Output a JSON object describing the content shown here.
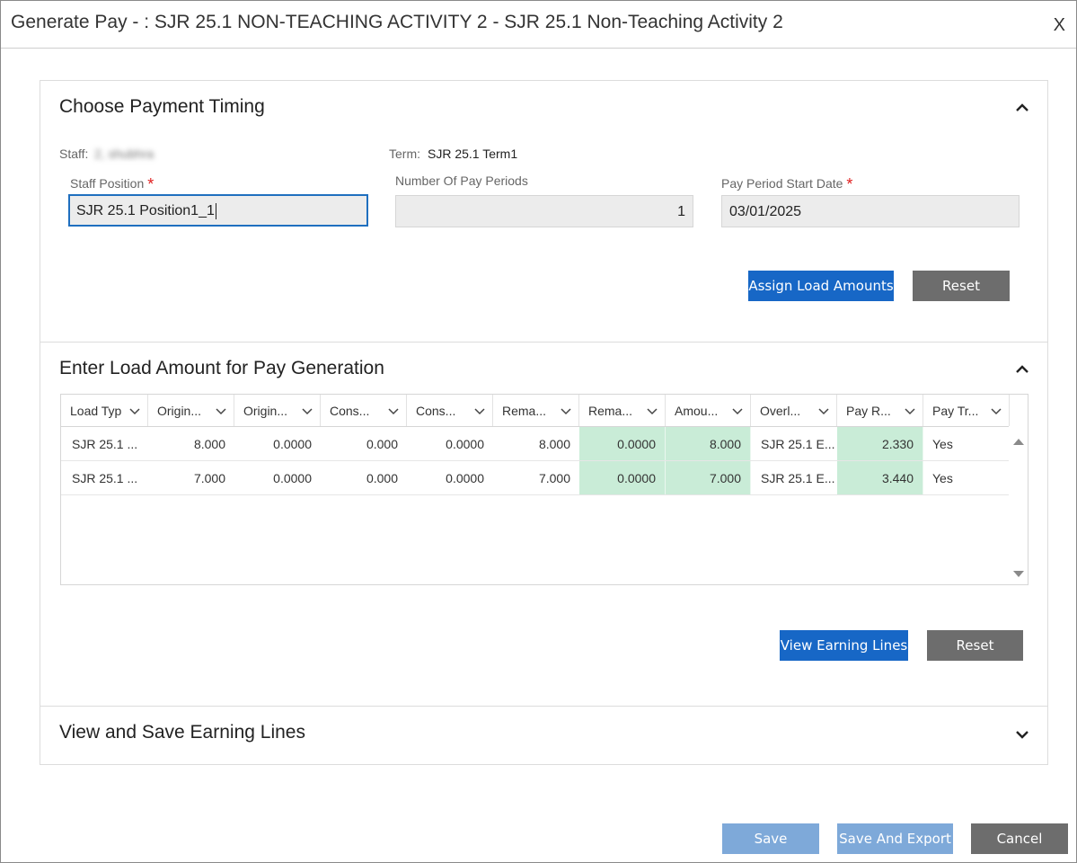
{
  "dialog": {
    "title": "Generate Pay - : SJR 25.1 NON-TEACHING ACTIVITY 2 - SJR 25.1 Non-Teaching Activity 2",
    "close_label": "X"
  },
  "timing": {
    "title": "Choose Payment Timing",
    "staff_label": "Staff:",
    "staff_value": "2, shubhra",
    "term_label": "Term:",
    "term_value": "SJR 25.1 Term1",
    "staff_position_label": "Staff Position",
    "staff_position_value": "SJR 25.1 Position1_1",
    "pay_periods_label": "Number Of Pay Periods",
    "pay_periods_value": "1",
    "start_date_label": "Pay Period Start Date",
    "start_date_value": "03/01/2025",
    "required_mark": "*",
    "assign_label": "Assign Load Amounts",
    "reset_label": "Reset"
  },
  "load": {
    "title": "Enter Load Amount for Pay Generation",
    "columns": [
      "Load Typ",
      "Origin...",
      "Origin...",
      "Cons...",
      "Cons...",
      "Rema...",
      "Rema...",
      "Amou...",
      "Overl...",
      "Pay R...",
      "Pay Tr..."
    ],
    "rows": [
      [
        "SJR 25.1 ...",
        "8.000",
        "0.0000",
        "0.000",
        "0.0000",
        "8.000",
        "0.0000",
        "8.000",
        "SJR 25.1 E...",
        "2.330",
        "Yes"
      ],
      [
        "SJR 25.1 ...",
        "7.000",
        "0.0000",
        "0.000",
        "0.0000",
        "7.000",
        "0.0000",
        "7.000",
        "SJR 25.1 E...",
        "3.440",
        "Yes"
      ]
    ],
    "view_label": "View Earning Lines",
    "reset_label": "Reset",
    "editable_color": "#c9ecd7"
  },
  "earning": {
    "title": "View and Save Earning Lines"
  },
  "footer": {
    "save_label": "Save",
    "save_export_label": "Save And Export",
    "cancel_label": "Cancel"
  },
  "colors": {
    "primary": "#1767c6",
    "disabled_primary": "#7ea9d9",
    "gray_button": "#6d6d6d",
    "required": "#e02020"
  }
}
